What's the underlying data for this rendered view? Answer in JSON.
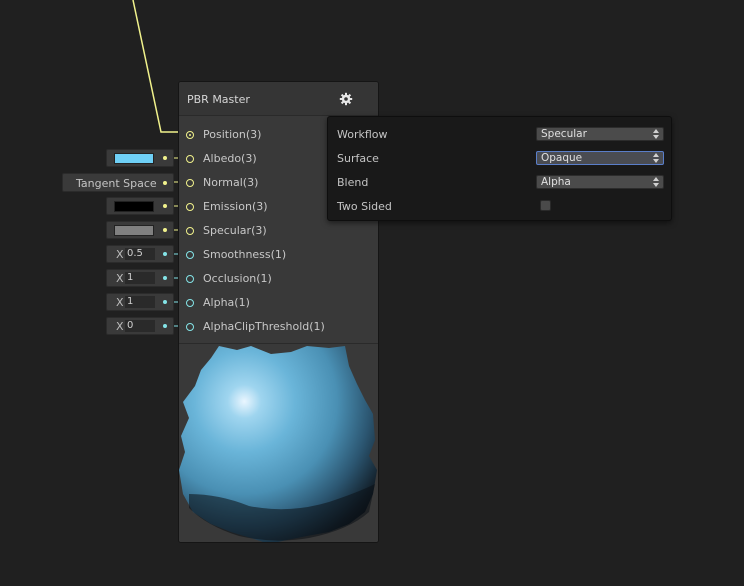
{
  "node": {
    "title": "PBR Master",
    "slots": [
      {
        "label": "Position(3)"
      },
      {
        "label": "Albedo(3)"
      },
      {
        "label": "Normal(3)"
      },
      {
        "label": "Emission(3)"
      },
      {
        "label": "Specular(3)"
      },
      {
        "label": "Smoothness(1)"
      },
      {
        "label": "Occlusion(1)"
      },
      {
        "label": "Alpha(1)"
      },
      {
        "label": "AlphaClipThreshold(1)"
      }
    ]
  },
  "inputs": {
    "albedo_color": "#6fd0f6",
    "normal_space": "Tangent Space",
    "emission_color": "#000000",
    "specular_color": "#808080",
    "smoothness": {
      "x_label": "X",
      "value": "0.5"
    },
    "occlusion": {
      "x_label": "X",
      "value": "1"
    },
    "alpha": {
      "x_label": "X",
      "value": "1"
    },
    "alpha_clip": {
      "x_label": "X",
      "value": "0"
    }
  },
  "settings": {
    "workflow": {
      "label": "Workflow",
      "value": "Specular"
    },
    "surface": {
      "label": "Surface",
      "value": "Opaque"
    },
    "blend": {
      "label": "Blend",
      "value": "Alpha"
    },
    "two_sided": {
      "label": "Two Sided",
      "checked": false
    }
  },
  "colors": {
    "vector3_port": "#f1f28c",
    "vector1_port": "#84e4e7",
    "background": "#202020",
    "node": "#393939"
  }
}
